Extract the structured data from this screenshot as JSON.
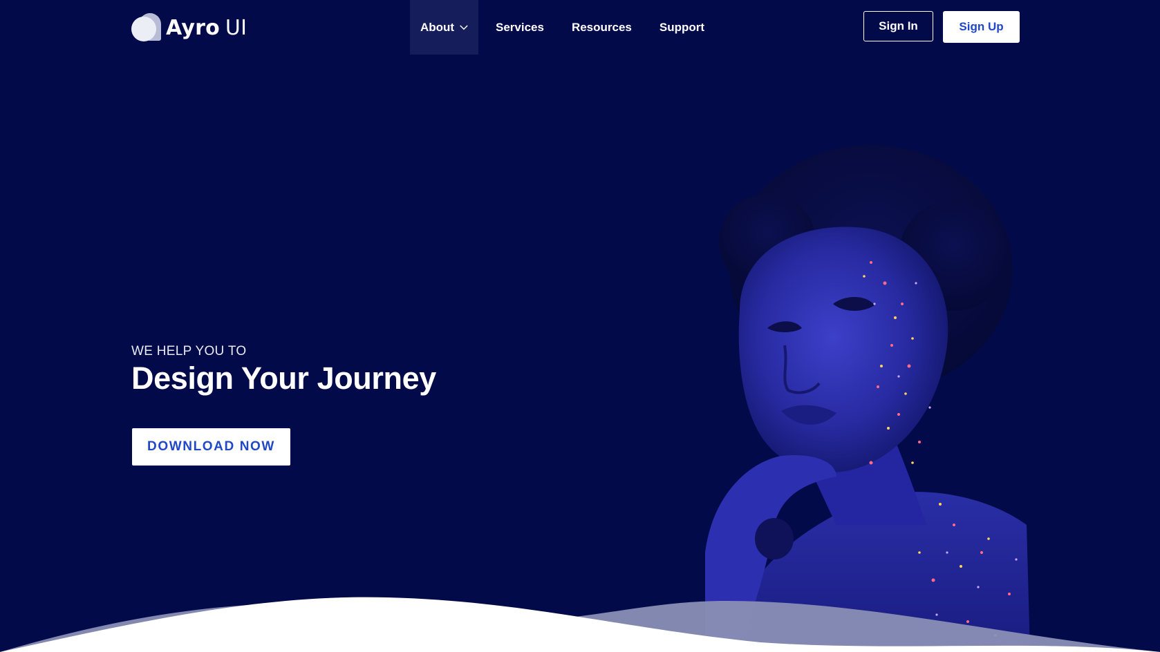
{
  "brand": {
    "name_bold": "Ayro",
    "name_light": "UI"
  },
  "nav": {
    "items": [
      {
        "label": "About",
        "has_dropdown": true,
        "active": true
      },
      {
        "label": "Services"
      },
      {
        "label": "Resources"
      },
      {
        "label": "Support"
      }
    ]
  },
  "auth": {
    "sign_in": "Sign In",
    "sign_up": "Sign Up"
  },
  "hero": {
    "eyebrow": "WE HELP YOU TO",
    "headline": "Design Your Journey",
    "cta": "DOWNLOAD NOW"
  },
  "colors": {
    "background": "#030a4a",
    "accent": "#1f47c7",
    "active_nav": "#151d5a",
    "wave_light": "#8a8fb5",
    "wave_white": "#ffffff"
  },
  "icons": {
    "dropdown": "chevron-down-icon"
  }
}
